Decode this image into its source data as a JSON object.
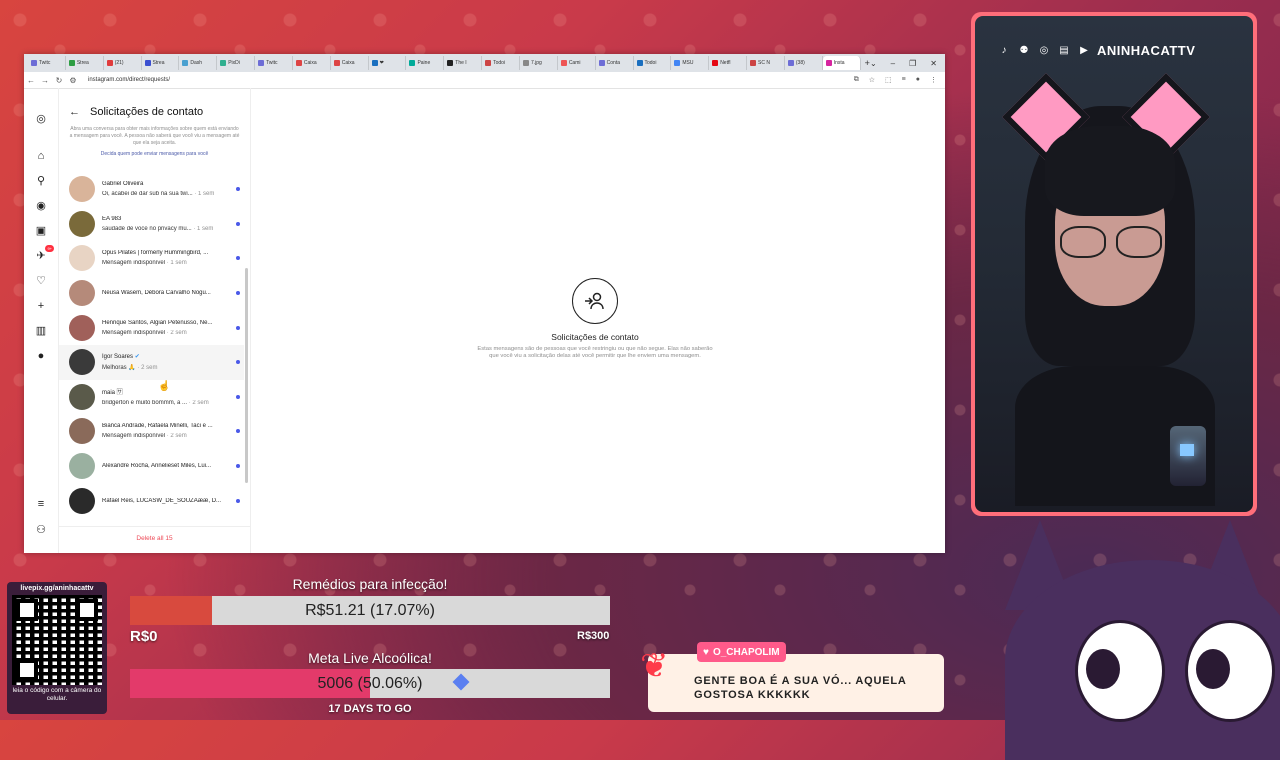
{
  "browser": {
    "tabs": [
      "Twitc",
      "Strea",
      "(21)",
      "Strea",
      "Dash",
      "PixDi",
      "Twitc",
      "Caixa",
      "Caixa",
      "❤",
      "Paine",
      "The I",
      "Todoi",
      "7.jpg",
      "Cami",
      "Conta",
      "Todoi",
      "MSU",
      "Netfl",
      "SC N",
      "(38)",
      "Insta"
    ],
    "url": "instagram.com/direct/requests/"
  },
  "instagram": {
    "requests_title": "Solicitações de contato",
    "info_text": "Abra uma conversa para obter mais informações sobre quem está enviando a mensagem para você. A pessoa não saberá que você viu a mensagem até que ela seja aceita.",
    "info_link": "Decida quem pode enviar mensagens para você",
    "items": [
      {
        "name": "Gabriel Oliveira",
        "msg": "Oi, acabei de dar sub na sua twi...",
        "time": " · 1 sem"
      },
      {
        "name": "EA 983",
        "msg": "saudade de voce no privacy mu...",
        "time": " · 1 sem"
      },
      {
        "name": "Opus Pilates | formerly Hummingbird, ...",
        "msg": "Mensagem indisponível",
        "time": " · 1 sem"
      },
      {
        "name": "Neusa Wasem, Débora Carvalho Nogu...",
        "msg": "",
        "time": ""
      },
      {
        "name": "Henrique Santos, Algian Petenusso, Ne...",
        "msg": "Mensagem indisponível",
        "time": " · 2 sem"
      },
      {
        "name": "Igor Soares",
        "msg": "Melhoras 🙏",
        "time": " · 2 sem"
      },
      {
        "name": "maia 🈂",
        "msg": "bridgerton e muito bommm, a ...",
        "time": " · 2 sem"
      },
      {
        "name": "Bianca Andrade, Rafaela Minelli, Taci e ...",
        "msg": "Mensagem indisponível",
        "time": " · 2 sem"
      },
      {
        "name": "Alexandre Rocha, Annelieset Miles, Lui...",
        "msg": "",
        "time": ""
      },
      {
        "name": "Rafael Reis, LUCASW_DE_SOUZAææ, D...",
        "msg": "",
        "time": ""
      }
    ],
    "delete_all": "Delete all 15",
    "empty_title": "Solicitações de contato",
    "empty_desc": "Estas mensagens são de pessoas que você restringiu ou que não segue. Elas não saberão que você viu a solicitação delas até você permitir que lhe enviem uma mensagem."
  },
  "stream": {
    "channel": "ANINHACATTV",
    "qr_top": "livepix.gg/aninhacattv",
    "qr_bottom": "leia o código com a câmera do celular.",
    "goal1": {
      "title": "Remédios para infecção!",
      "text": "R$51.21 (17.07%)",
      "min": "R$0",
      "max": "R$300",
      "percent": 17.07
    },
    "goal2": {
      "title": "Meta Live Alcoólica!",
      "text": "5006 (50.06%)",
      "percent": 50.06,
      "days": "17 DAYS TO GO"
    },
    "chat": {
      "user": "O_CHAPOLIM",
      "message": "GENTE BOA É A SUA VÓ... AQUELA GOSTOSA KKKKKK"
    }
  },
  "colors": {
    "accent": "#ff5a8a",
    "goal1_fill": "#d84a3e",
    "goal2_fill": "#e33a6a",
    "unread_dot": "#4a59e8"
  }
}
